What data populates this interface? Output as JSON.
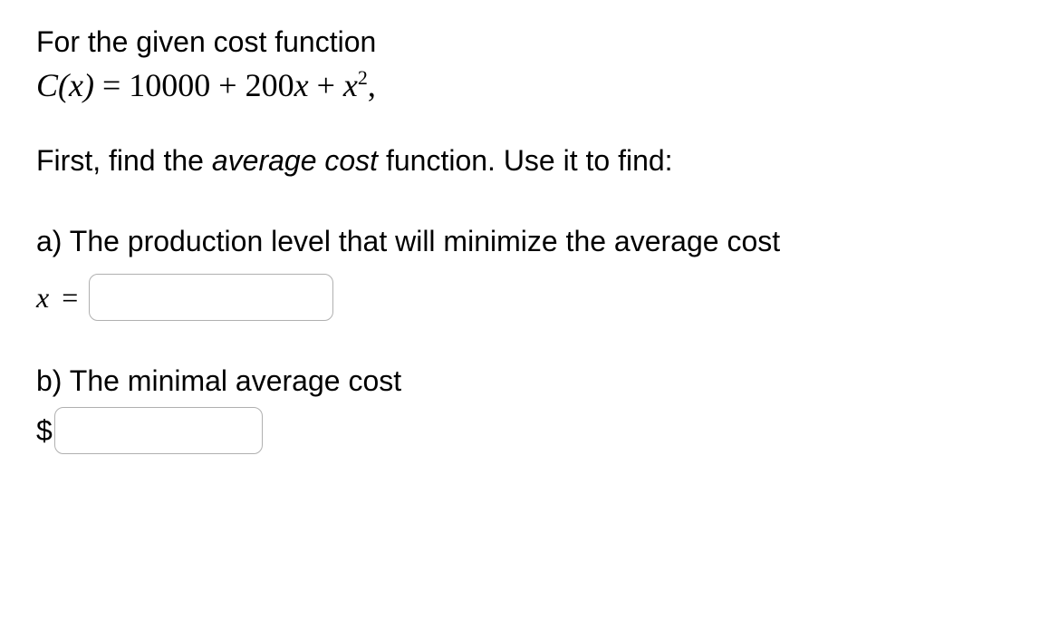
{
  "intro": "For the given cost function",
  "equation": {
    "lhs": "C(x)",
    "eq": " = ",
    "rhs_const": "10000",
    "rhs_plus1": " + ",
    "rhs_linear_coef": "200",
    "rhs_linear_var": "x",
    "rhs_plus2": " + ",
    "rhs_quad_var": "x",
    "rhs_quad_exp": "2",
    "trailing": ","
  },
  "instruction_pre": "First, find the ",
  "instruction_em": "average cost",
  "instruction_post": " function. Use it to find:",
  "part_a": {
    "prompt": "a) The production level that will minimize the average cost",
    "label_var": "x",
    "label_eq": "=",
    "value": ""
  },
  "part_b": {
    "prompt": "b) The minimal average cost",
    "currency": "$",
    "value": ""
  }
}
